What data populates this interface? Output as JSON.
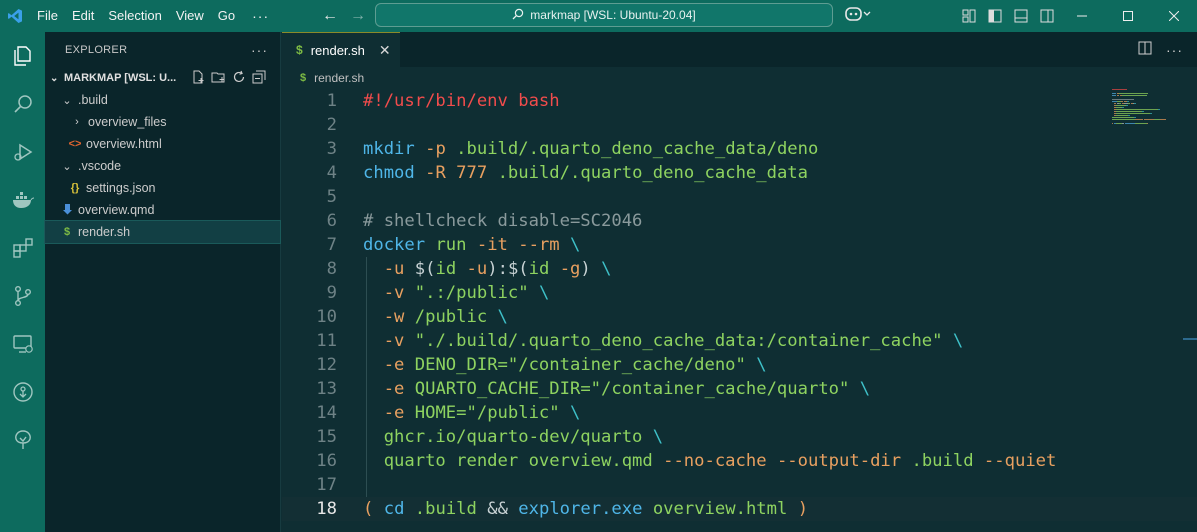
{
  "titlebar": {
    "menu": [
      "File",
      "Edit",
      "Selection",
      "View",
      "Go"
    ],
    "more": "···",
    "search_text": "markmap [WSL: Ubuntu-20.04]"
  },
  "sidebar": {
    "title": "EXPLORER",
    "more": "···",
    "folder": "MARKMAP [WSL: U...",
    "items": [
      {
        "label": ".build",
        "icon": "chevron-down"
      },
      {
        "label": "overview_files",
        "icon": "chevron-right"
      },
      {
        "label": "overview.html",
        "icon": "html-icon"
      },
      {
        "label": ".vscode",
        "icon": "chevron-down"
      },
      {
        "label": "settings.json",
        "icon": "json-icon"
      },
      {
        "label": "overview.qmd",
        "icon": "quarto-icon"
      },
      {
        "label": "render.sh",
        "icon": "shell-icon"
      }
    ]
  },
  "editor": {
    "tab_label": "render.sh",
    "tab_icon": "$",
    "breadcrumb": "render.sh",
    "current_line": 18,
    "lines": [
      {
        "n": "1",
        "tokens": [
          [
            "#!/usr/bin/env bash",
            "shebang"
          ]
        ]
      },
      {
        "n": "2",
        "tokens": []
      },
      {
        "n": "3",
        "tokens": [
          [
            "mkdir",
            "cmd"
          ],
          [
            " ",
            "plain"
          ],
          [
            "-p",
            "flag"
          ],
          [
            " .build/.quarto_deno_cache_data/deno",
            "str"
          ]
        ]
      },
      {
        "n": "4",
        "tokens": [
          [
            "chmod",
            "cmd"
          ],
          [
            " ",
            "plain"
          ],
          [
            "-R",
            "flag"
          ],
          [
            " ",
            "plain"
          ],
          [
            "777",
            "flag"
          ],
          [
            " .build/.quarto_deno_cache_data",
            "str"
          ]
        ]
      },
      {
        "n": "5",
        "tokens": []
      },
      {
        "n": "6",
        "tokens": [
          [
            "# shellcheck disable=SC2046",
            "comment"
          ]
        ]
      },
      {
        "n": "7",
        "tokens": [
          [
            "docker",
            "cmd"
          ],
          [
            " run ",
            "str"
          ],
          [
            "-it",
            "flag"
          ],
          [
            " ",
            "plain"
          ],
          [
            "--rm",
            "flag"
          ],
          [
            " \\",
            "esc"
          ]
        ]
      },
      {
        "n": "8",
        "tokens": [
          [
            "  ",
            "plain"
          ],
          [
            "-u",
            "flag"
          ],
          [
            " ",
            "plain"
          ],
          [
            "$(",
            "plain"
          ],
          [
            "id",
            "str"
          ],
          [
            " ",
            "plain"
          ],
          [
            "-u",
            "flag"
          ],
          [
            "):",
            "plain"
          ],
          [
            "$(",
            "plain"
          ],
          [
            "id",
            "str"
          ],
          [
            " ",
            "plain"
          ],
          [
            "-g",
            "flag"
          ],
          [
            ")",
            "plain"
          ],
          [
            " \\",
            "esc"
          ]
        ]
      },
      {
        "n": "9",
        "tokens": [
          [
            "  ",
            "plain"
          ],
          [
            "-v",
            "flag"
          ],
          [
            " \".:/public\"",
            "str"
          ],
          [
            " \\",
            "esc"
          ]
        ]
      },
      {
        "n": "10",
        "tokens": [
          [
            "  ",
            "plain"
          ],
          [
            "-w",
            "flag"
          ],
          [
            " /public",
            "str"
          ],
          [
            " \\",
            "esc"
          ]
        ]
      },
      {
        "n": "11",
        "tokens": [
          [
            "  ",
            "plain"
          ],
          [
            "-v",
            "flag"
          ],
          [
            " \"./.build/.quarto_deno_cache_data:/container_cache\"",
            "str"
          ],
          [
            " \\",
            "esc"
          ]
        ]
      },
      {
        "n": "12",
        "tokens": [
          [
            "  ",
            "plain"
          ],
          [
            "-e",
            "flag"
          ],
          [
            " DENO_DIR=\"/container_cache/deno\"",
            "str"
          ],
          [
            " \\",
            "esc"
          ]
        ]
      },
      {
        "n": "13",
        "tokens": [
          [
            "  ",
            "plain"
          ],
          [
            "-e",
            "flag"
          ],
          [
            " QUARTO_CACHE_DIR=\"/container_cache/quarto\"",
            "str"
          ],
          [
            " \\",
            "esc"
          ]
        ]
      },
      {
        "n": "14",
        "tokens": [
          [
            "  ",
            "plain"
          ],
          [
            "-e",
            "flag"
          ],
          [
            " HOME=\"/public\"",
            "str"
          ],
          [
            " \\",
            "esc"
          ]
        ]
      },
      {
        "n": "15",
        "tokens": [
          [
            "  ghcr.io/quarto-dev/quarto",
            "str"
          ],
          [
            " \\",
            "esc"
          ]
        ]
      },
      {
        "n": "16",
        "tokens": [
          [
            "  quarto render overview.qmd ",
            "str"
          ],
          [
            "--no-cache",
            "flag"
          ],
          [
            " ",
            "plain"
          ],
          [
            "--output-dir",
            "flag"
          ],
          [
            " .build ",
            "str"
          ],
          [
            "--quiet",
            "flag"
          ]
        ]
      },
      {
        "n": "17",
        "tokens": []
      },
      {
        "n": "18",
        "tokens": [
          [
            "(",
            "paren"
          ],
          [
            " ",
            "plain"
          ],
          [
            "cd",
            "cmd"
          ],
          [
            " .build ",
            "str"
          ],
          [
            "&&",
            "op"
          ],
          [
            " ",
            "plain"
          ],
          [
            "explorer.exe",
            "cmd"
          ],
          [
            " overview.html ",
            "str"
          ],
          [
            ")",
            "paren"
          ]
        ]
      }
    ]
  },
  "colors": {
    "titlebar_bg": "#0d6b5e",
    "sidebar_bg": "#0a252a",
    "editor_bg": "#0f2e33",
    "string": "#8ed360",
    "command": "#4fb6e8",
    "flag": "#e8a060",
    "shebang": "#f14c4c"
  }
}
